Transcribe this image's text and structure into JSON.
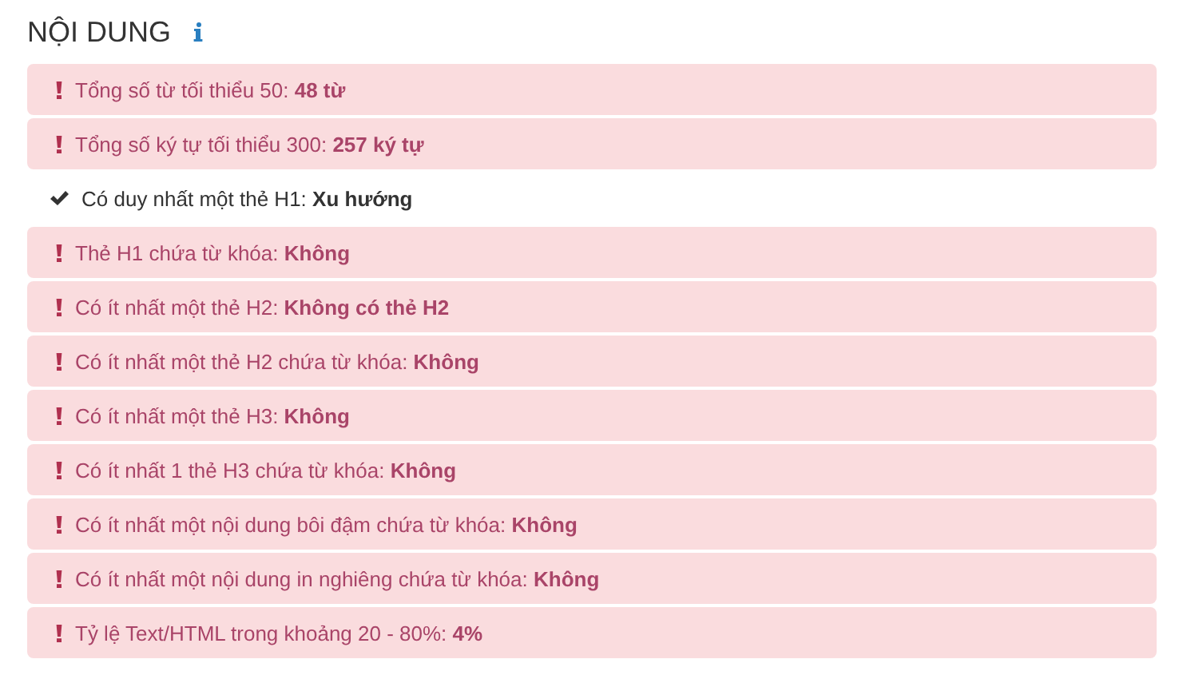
{
  "section": {
    "title": "NỘI DUNG"
  },
  "checks": [
    {
      "kind": "fail",
      "text": "Tổng số từ tối thiểu 50: **48 từ**"
    },
    {
      "kind": "fail",
      "text": "Tổng số ký tự tối thiểu 300: **257 ký tự**"
    },
    {
      "kind": "pass",
      "text": "Có duy nhất một thẻ H1: **Xu hướng**"
    },
    {
      "kind": "fail",
      "text": "Thẻ H1 chứa từ khóa: **Không**"
    },
    {
      "kind": "fail",
      "text": "Có ít nhất một thẻ H2: **Không có thẻ H2**"
    },
    {
      "kind": "fail",
      "text": "Có ít nhất một thẻ H2 chứa từ khóa: **Không**"
    },
    {
      "kind": "fail",
      "text": "Có ít nhất một thẻ H3: **Không**"
    },
    {
      "kind": "fail",
      "text": "Có ít nhất 1 thẻ H3 chứa từ khóa: **Không**"
    },
    {
      "kind": "fail",
      "text": "Có ít nhất một nội dung bôi đậm chứa từ khóa: **Không**"
    },
    {
      "kind": "fail",
      "text": "Có ít nhất một nội dung in nghiêng chứa từ khóa: **Không**"
    },
    {
      "kind": "fail",
      "text": "Tỷ lệ Text/HTML trong khoảng 20 - 80%: **4%**"
    }
  ]
}
